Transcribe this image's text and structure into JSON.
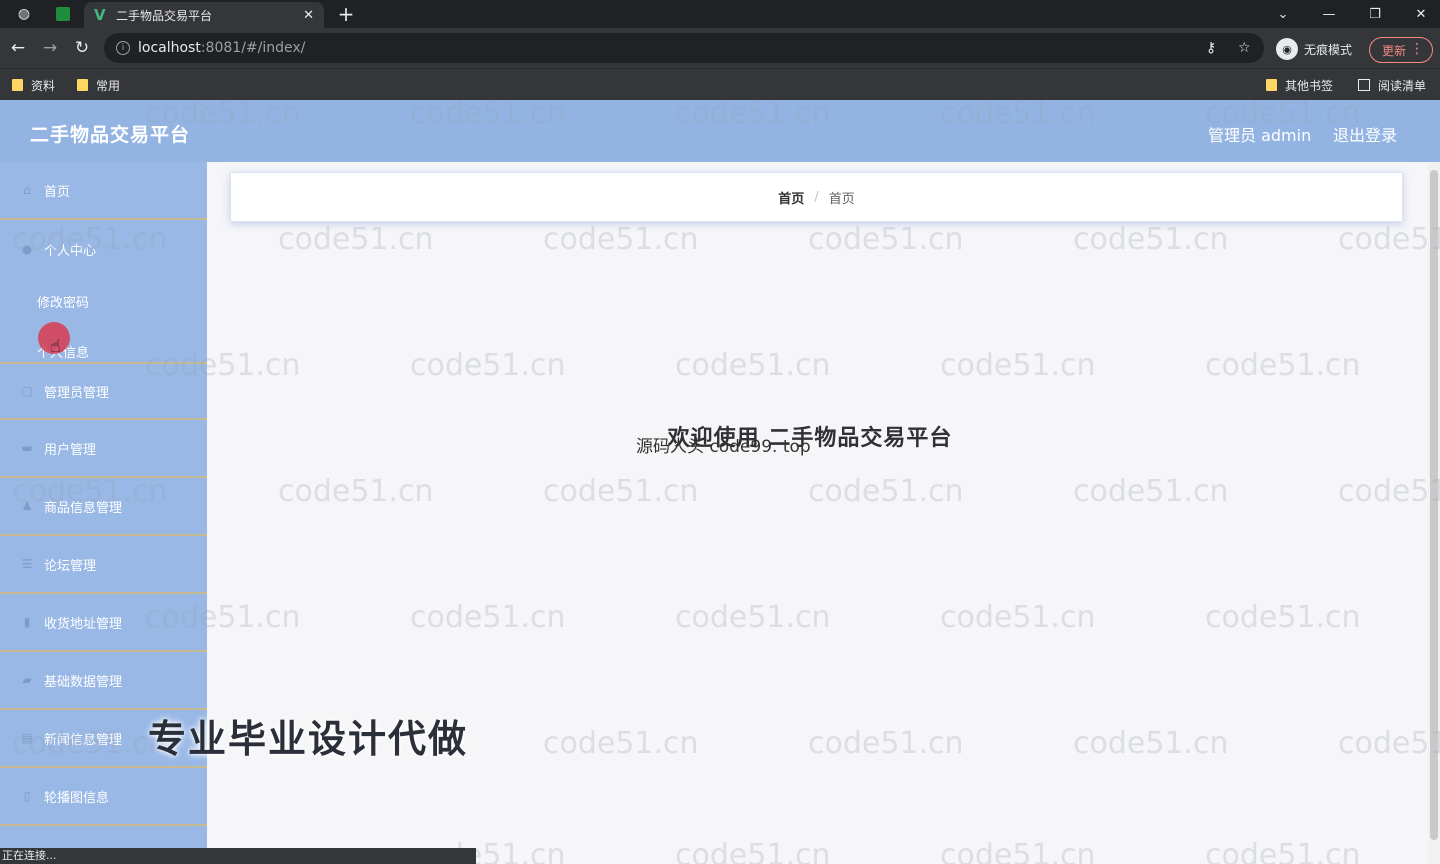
{
  "browser": {
    "tab_title": "二手物品交易平台",
    "url_host": "localhost",
    "url_path": ":8081/#/index/",
    "profile_label": "无痕模式",
    "update_label": "更新",
    "bookmarks": [
      "资料",
      "常用"
    ],
    "other_bookmarks": "其他书签",
    "reading_list": "阅读清单",
    "status_text": "正在连接..."
  },
  "header": {
    "title": "二手物品交易平台",
    "admin_label": "管理员 admin",
    "logout_label": "退出登录"
  },
  "sidebar": {
    "items": [
      {
        "label": "首页",
        "icon": "home-icon"
      },
      {
        "label": "个人中心",
        "icon": "user-icon"
      },
      {
        "label": "修改密码"
      },
      {
        "label": "个人信息"
      },
      {
        "label": "管理员管理",
        "icon": "admin-icon"
      },
      {
        "label": "用户管理",
        "icon": "users-icon"
      },
      {
        "label": "商品信息管理",
        "icon": "goods-icon"
      },
      {
        "label": "论坛管理",
        "icon": "forum-icon"
      },
      {
        "label": "收货地址管理",
        "icon": "chart-icon"
      },
      {
        "label": "基础数据管理",
        "icon": "data-icon"
      },
      {
        "label": "新闻信息管理",
        "icon": "news-icon"
      },
      {
        "label": "轮播图信息",
        "icon": "carousel-icon"
      }
    ]
  },
  "breadcrumb": {
    "home": "首页",
    "separator": "/",
    "current": "首页"
  },
  "main": {
    "welcome": "欢迎使用 二手物品交易平台"
  },
  "overlays": {
    "source_text": "源码人头 code99. top",
    "ad_text": "专业毕业设计代做",
    "watermark": "code51.cn"
  },
  "colors": {
    "header_bg": "#93b4e3",
    "sidebar_bg": "#99b8e6",
    "divider": "#c7b98f"
  }
}
